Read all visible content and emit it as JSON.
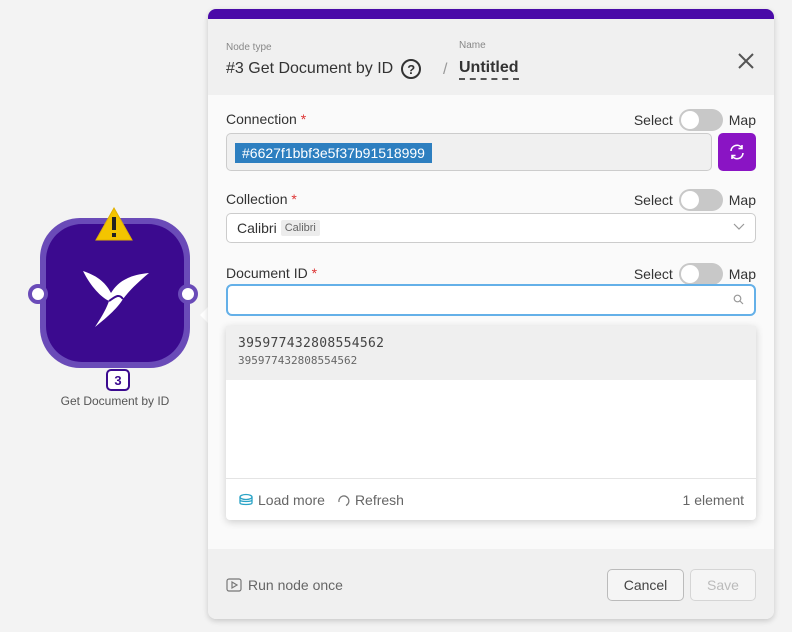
{
  "node": {
    "badge": "3",
    "label": "Get Document by ID",
    "warning_icon": "warning-triangle-icon",
    "app_icon": "bird-icon"
  },
  "panel": {
    "node_type_label": "Node type",
    "node_type_value": "#3 Get Document by ID",
    "name_label": "Name",
    "name_value": "Untitled",
    "accent_color": "#4a0aa8"
  },
  "fields": {
    "connection": {
      "label": "Connection",
      "required": "*",
      "toggle_left": "Select",
      "toggle_right": "Map",
      "value": "#6627f1bbf3e5f37b91518999"
    },
    "collection": {
      "label": "Collection",
      "required": "*",
      "toggle_left": "Select",
      "toggle_right": "Map",
      "value": "Calibri",
      "tag": "Calibri"
    },
    "document_id": {
      "label": "Document ID",
      "required": "*",
      "toggle_left": "Select",
      "toggle_right": "Map",
      "value": ""
    }
  },
  "dropdown": {
    "items": [
      {
        "main": "395977432808554562",
        "sub": "395977432808554562"
      }
    ],
    "load_more": "Load more",
    "refresh": "Refresh",
    "count": "1 element"
  },
  "footer": {
    "run_once": "Run node once",
    "cancel": "Cancel",
    "save": "Save"
  }
}
